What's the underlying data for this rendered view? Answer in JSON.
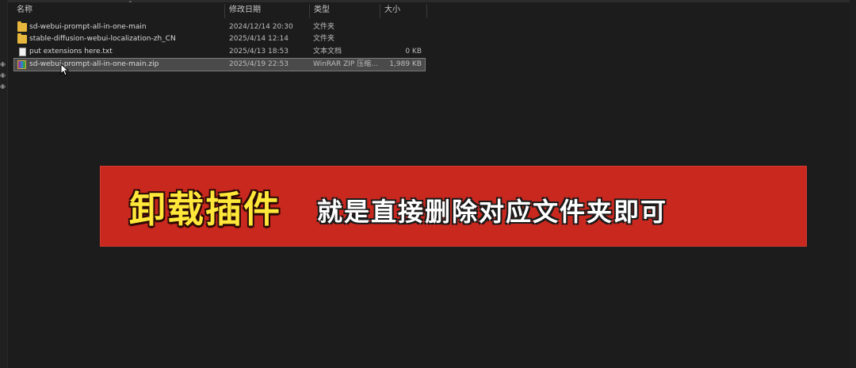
{
  "columns": {
    "name": "名称",
    "modified": "修改日期",
    "type": "类型",
    "size": "大小"
  },
  "files": [
    {
      "name": "sd-webui-prompt-all-in-one-main",
      "modified": "2024/12/14 20:30",
      "type": "文件夹",
      "size": "",
      "icon": "folder-icon"
    },
    {
      "name": "stable-diffusion-webui-localization-zh_CN",
      "modified": "2025/4/14 12:14",
      "type": "文件夹",
      "size": "",
      "icon": "folder-icon"
    },
    {
      "name": "put extensions here.txt",
      "modified": "2025/4/13 18:53",
      "type": "文本文档",
      "size": "0 KB",
      "icon": "text-file-icon"
    },
    {
      "name": "sd-webui-prompt-all-in-one-main.zip",
      "modified": "2025/4/19 22:53",
      "type": "WinRAR ZIP 压缩...",
      "size": "1,989 KB",
      "icon": "zip-archive-icon",
      "selected": true
    }
  ],
  "caption": {
    "highlight": "卸载插件",
    "rest": "就是直接删除对应文件夹即可"
  },
  "colors": {
    "banner": "#c9281f",
    "highlight_text": "#ffe83a",
    "folder": "#e7b73d",
    "background": "#1c1c1c"
  }
}
